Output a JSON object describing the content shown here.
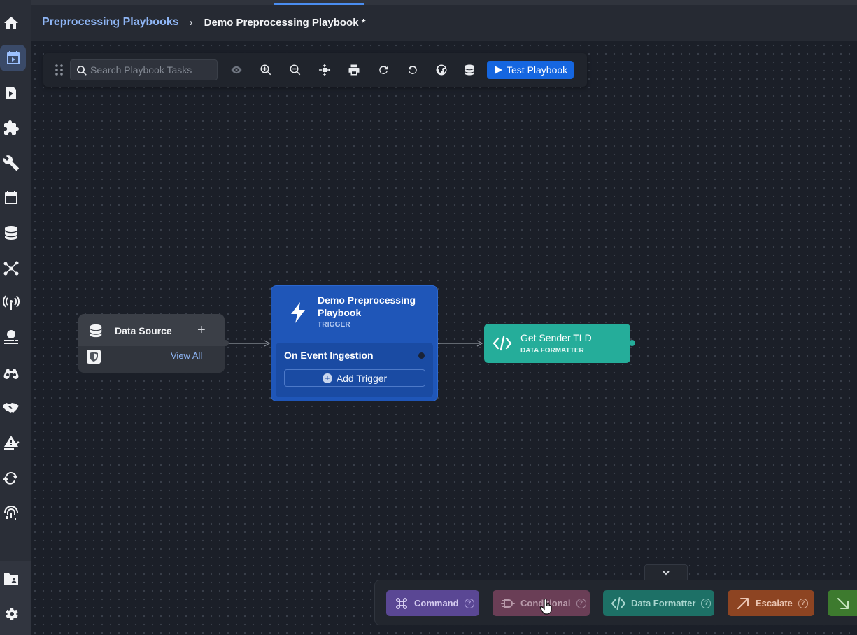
{
  "header": {
    "breadcrumb_parent": "Preprocessing Playbooks",
    "breadcrumb_separator": "›",
    "breadcrumb_current": "Demo Preprocessing Playbook *"
  },
  "sidebar": {
    "items": [
      {
        "name": "home",
        "icon": "home-icon"
      },
      {
        "name": "playbooks",
        "icon": "calendar-play-icon",
        "active": true
      },
      {
        "name": "automation",
        "icon": "play-document-icon"
      },
      {
        "name": "integrations",
        "icon": "puzzle-icon"
      },
      {
        "name": "tools",
        "icon": "wrench-screwdriver-icon"
      },
      {
        "name": "schedules",
        "icon": "calendar-icon"
      },
      {
        "name": "data",
        "icon": "database-icon"
      },
      {
        "name": "connections",
        "icon": "network-icon"
      },
      {
        "name": "connectors",
        "icon": "antenna-icon"
      },
      {
        "name": "threat-intel",
        "icon": "globe-list-icon"
      },
      {
        "name": "hunting",
        "icon": "binoculars-icon"
      },
      {
        "name": "partners",
        "icon": "handshake-icon"
      },
      {
        "name": "rules",
        "icon": "alert-edit-icon"
      },
      {
        "name": "sync",
        "icon": "sync-icon"
      },
      {
        "name": "identity",
        "icon": "fingerprint-icon"
      },
      {
        "name": "cases",
        "icon": "folder-user-icon"
      },
      {
        "name": "settings",
        "icon": "gear-icon"
      }
    ]
  },
  "toolbar": {
    "search_placeholder": "Search Playbook Tasks",
    "test_label": "Test Playbook",
    "buttons": [
      "eye-icon",
      "zoom-in-icon",
      "zoom-out-icon",
      "fit-screen-icon",
      "print-icon",
      "redo-icon",
      "undo-icon",
      "globe-icon",
      "database-icon"
    ]
  },
  "nodes": {
    "data_source": {
      "title": "Data Source",
      "add": "+",
      "link": "View All"
    },
    "trigger": {
      "title": "Demo Preprocessing Playbook",
      "subtitle": "TRIGGER",
      "event": "On Event Ingestion",
      "add_label": "Add Trigger"
    },
    "formatter": {
      "title": "Get Sender TLD",
      "subtitle": "DATA FORMATTER"
    }
  },
  "palette": {
    "help_glyph": "?",
    "items": [
      {
        "label": "Command",
        "icon": "command-icon"
      },
      {
        "label": "Conditional",
        "icon": "conditional-icon"
      },
      {
        "label": "Data Formatter",
        "icon": "code-icon"
      },
      {
        "label": "Escalate",
        "icon": "arrow-up-right-icon"
      },
      {
        "label": "",
        "icon": "arrow-down-right-icon"
      }
    ]
  },
  "colors": {
    "accent": "#1566e0",
    "trigger": "#1f56b8",
    "formatter": "#25ad9a",
    "link": "#8fb6f6"
  }
}
